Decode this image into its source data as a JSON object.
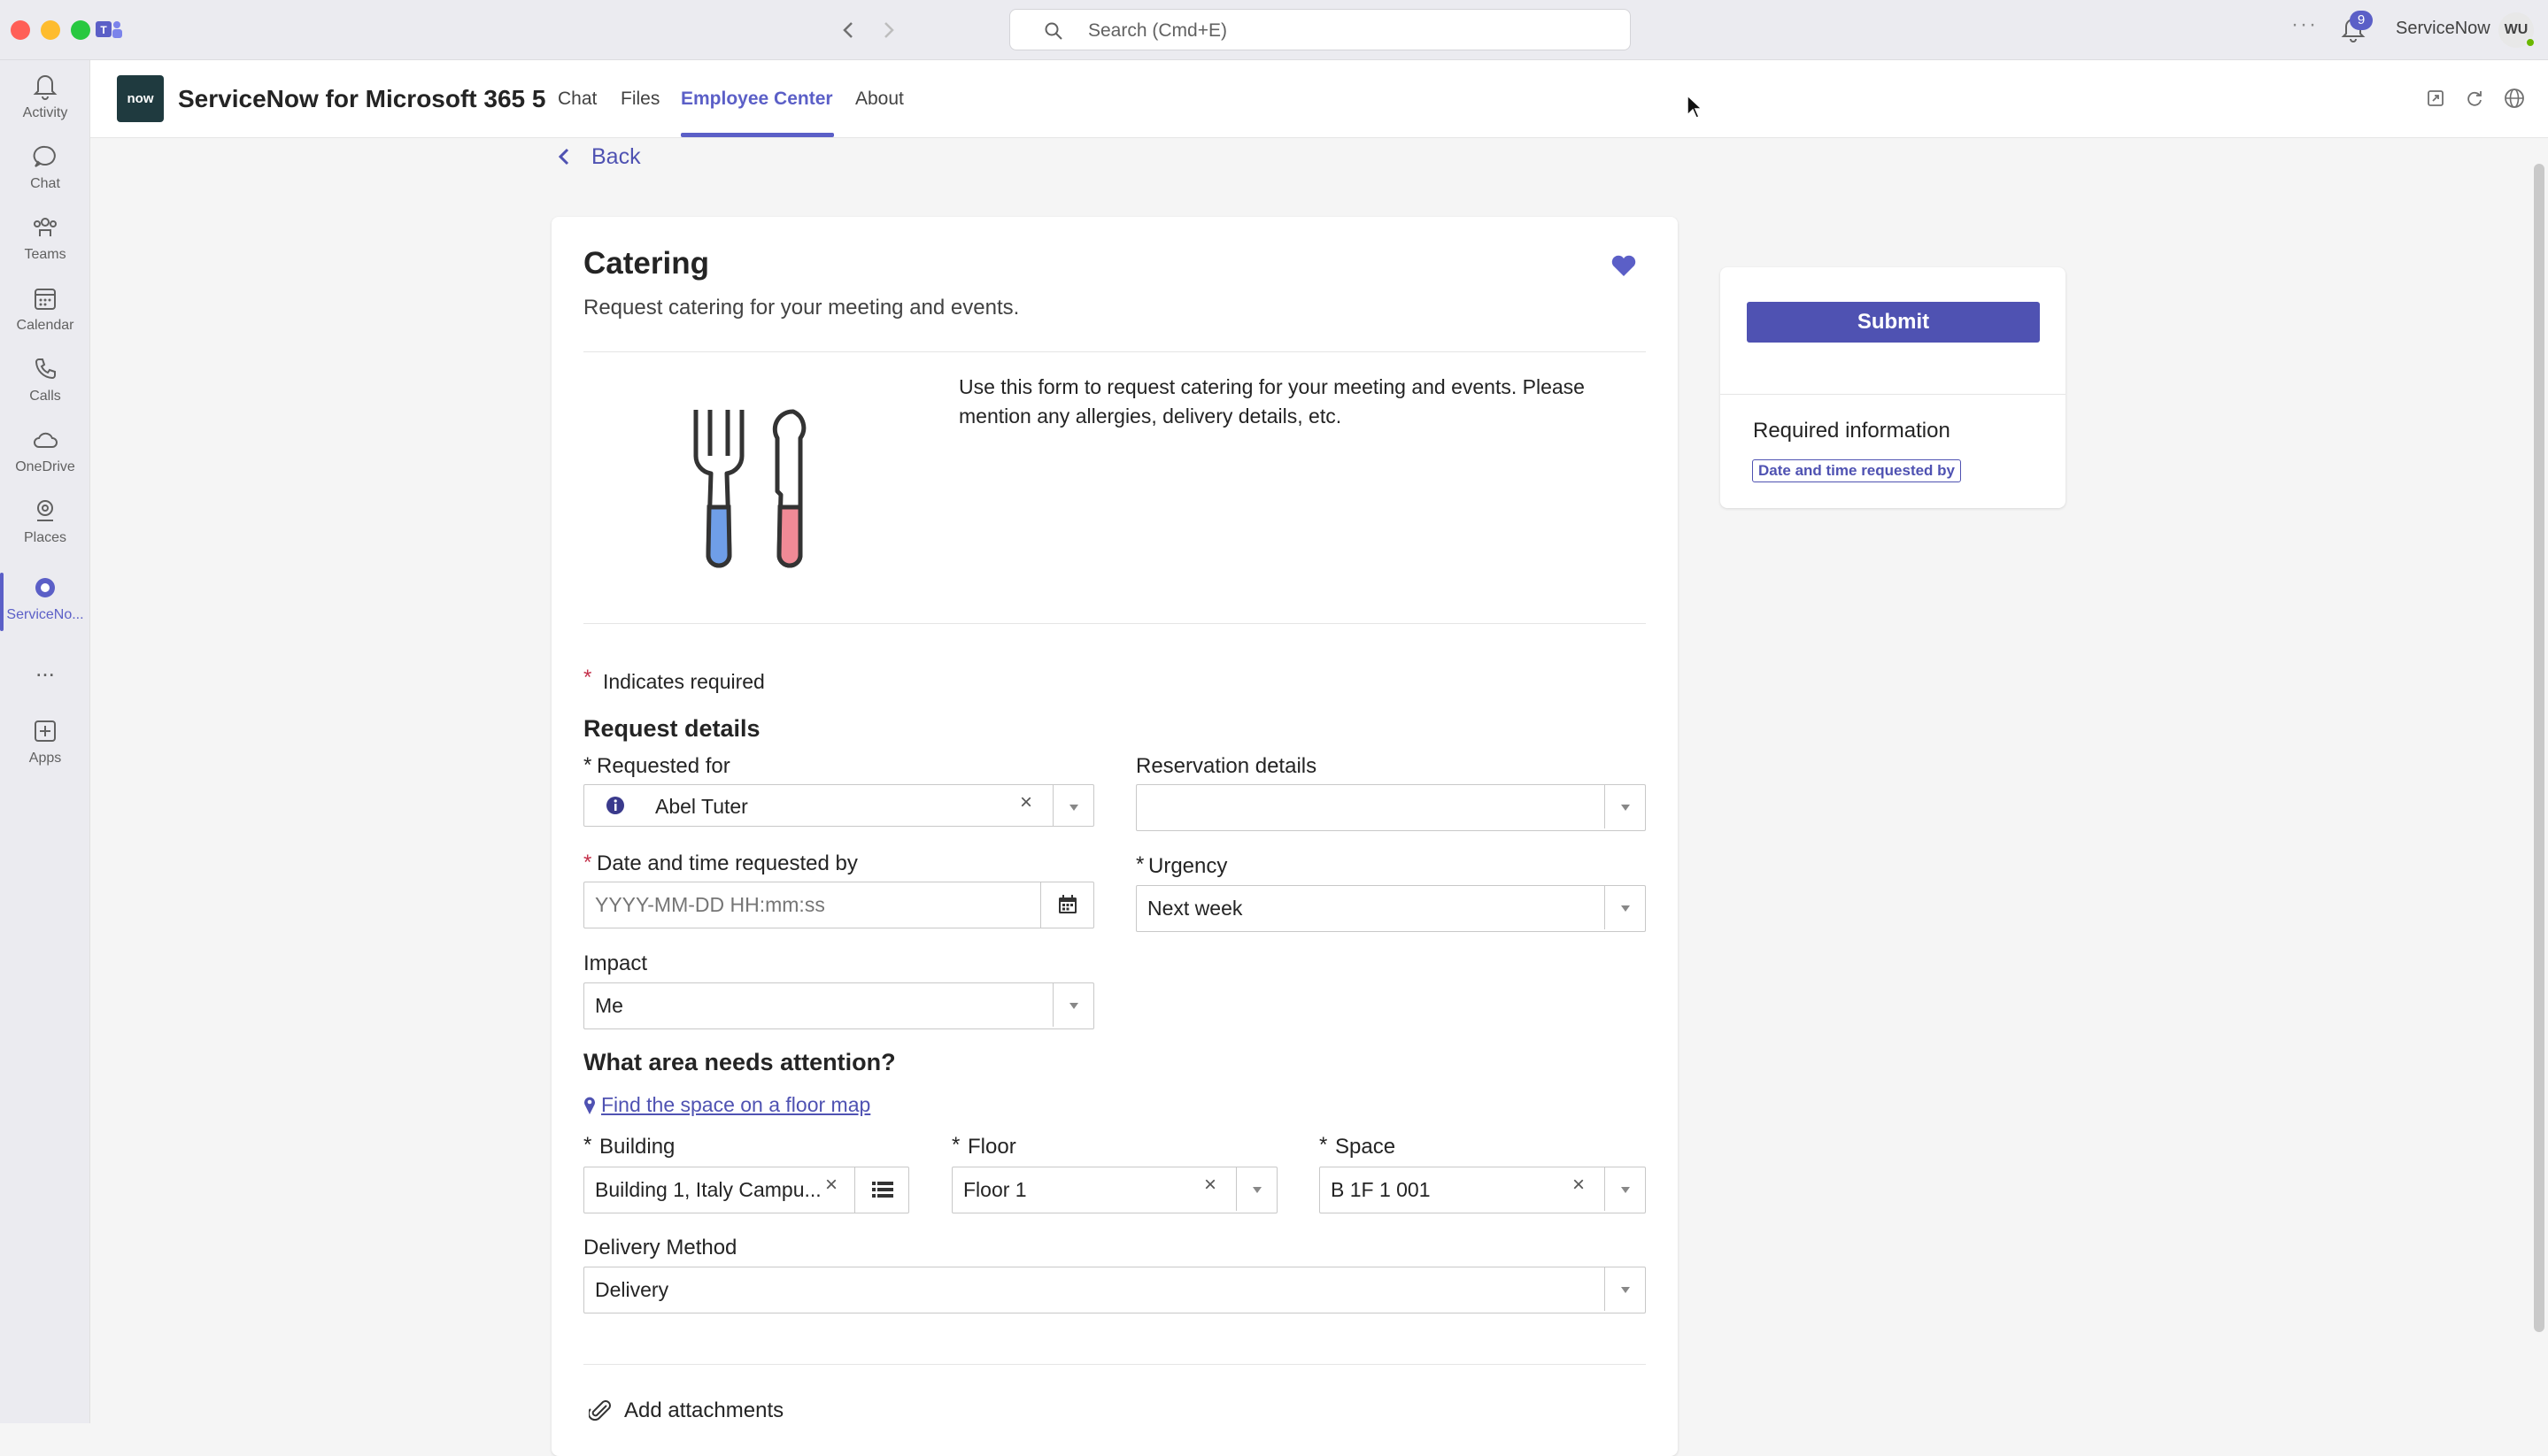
{
  "titlebar": {
    "search_placeholder": "Search (Cmd+E)",
    "notification_count": "9",
    "account_name": "ServiceNow",
    "avatar_initials": "WU"
  },
  "rail": {
    "items": [
      {
        "label": "Activity",
        "icon": "bell-icon"
      },
      {
        "label": "Chat",
        "icon": "chat-icon"
      },
      {
        "label": "Teams",
        "icon": "teams-icon"
      },
      {
        "label": "Calendar",
        "icon": "calendar-icon"
      },
      {
        "label": "Calls",
        "icon": "phone-icon"
      },
      {
        "label": "OneDrive",
        "icon": "cloud-icon"
      },
      {
        "label": "Places",
        "icon": "places-icon"
      },
      {
        "label": "ServiceNo...",
        "icon": "servicenow-icon"
      },
      {
        "label": "...",
        "icon": "more-icon"
      },
      {
        "label": "Apps",
        "icon": "add-app-icon"
      }
    ]
  },
  "app": {
    "logo_text": "now",
    "title": "ServiceNow for Microsoft 365 5",
    "tabs": [
      "Chat",
      "Files",
      "Employee Center",
      "About"
    ],
    "active_tab": "Employee Center"
  },
  "form": {
    "back_label": "Back",
    "title": "Catering",
    "subtitle": "Request catering for your meeting and events.",
    "description": "Use this form to request catering for your meeting and events. Please mention any allergies, delivery details, etc.",
    "required_marker": "*",
    "indicates_required": "Indicates required",
    "section_request": "Request details",
    "requested_for_label": "Requested for",
    "requested_for_value": "Abel Tuter",
    "reservation_label": "Reservation details",
    "reservation_value": "",
    "datetime_label": "Date and time requested by",
    "datetime_placeholder": "YYYY-MM-DD HH:mm:ss",
    "urgency_label": "Urgency",
    "urgency_value": "Next week",
    "impact_label": "Impact",
    "impact_value": "Me",
    "section_area": "What area needs attention?",
    "floor_map_link": "Find the space on a floor map",
    "building_label": "Building",
    "building_value": "Building 1, Italy Campu...",
    "floor_label": "Floor",
    "floor_value": "Floor 1",
    "space_label": "Space",
    "space_value": "B 1F 1 001",
    "delivery_label": "Delivery Method",
    "delivery_value": "Delivery",
    "attachments_label": "Add attachments"
  },
  "sidebar": {
    "submit_label": "Submit",
    "required_info_title": "Required information",
    "required_chip": "Date and time requested by"
  },
  "colors": {
    "accent": "#5b5fc7",
    "submit": "#4f52b2",
    "required": "#c4314b",
    "link": "#4f52b2"
  }
}
